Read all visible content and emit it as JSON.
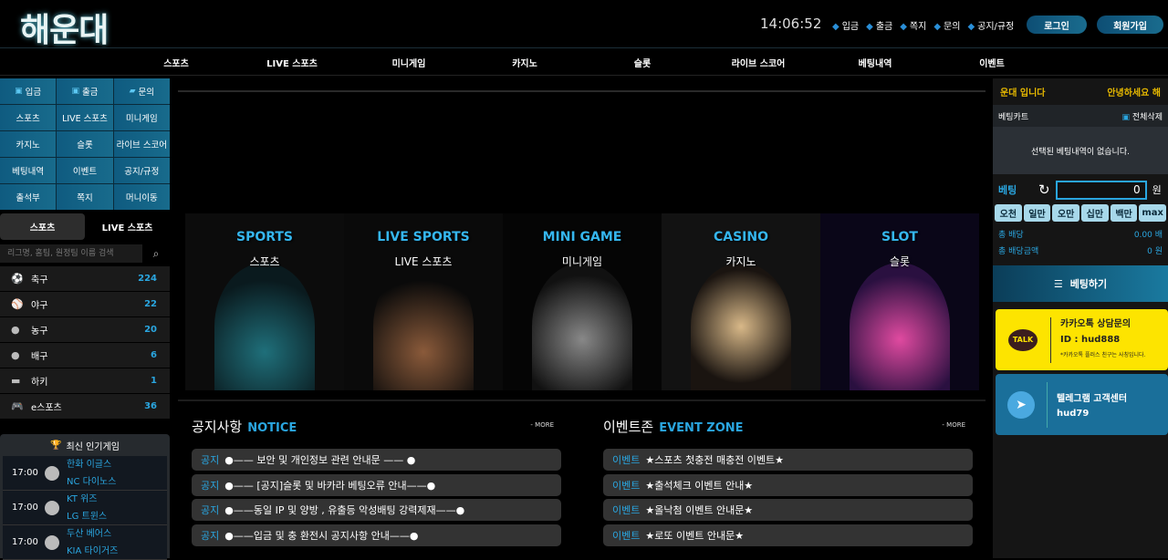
{
  "header": {
    "logo": "해운대",
    "clock": "14:06:52",
    "links": [
      "입금",
      "출금",
      "쪽지",
      "문의",
      "공지/규정"
    ],
    "login": "로그인",
    "signup": "회원가입"
  },
  "nav": [
    "스포츠",
    "LIVE 스포츠",
    "미니게임",
    "카지노",
    "슬롯",
    "라이브 스코어",
    "베팅내역",
    "이벤트"
  ],
  "quick": [
    "입금",
    "출금",
    "문의",
    "스포츠",
    "LIVE 스포츠",
    "미니게임",
    "카지노",
    "슬롯",
    "라이브 스코어",
    "베팅내역",
    "이벤트",
    "공지/규정",
    "출석부",
    "쪽지",
    "머니이동"
  ],
  "tabs": [
    "스포츠",
    "LIVE 스포츠"
  ],
  "search": {
    "placeholder": "리그명, 홈팀, 원정팀 이름 검색"
  },
  "sports": [
    {
      "icon": "soccer-ball-icon",
      "name": "축구",
      "count": "224"
    },
    {
      "icon": "baseball-icon",
      "name": "야구",
      "count": "22"
    },
    {
      "icon": "basketball-icon",
      "name": "농구",
      "count": "20"
    },
    {
      "icon": "volleyball-icon",
      "name": "배구",
      "count": "6"
    },
    {
      "icon": "hockey-puck-icon",
      "name": "하키",
      "count": "1"
    },
    {
      "icon": "gamepad-icon",
      "name": "e스포츠",
      "count": "36"
    }
  ],
  "popular": {
    "title": "최신 인기게임",
    "games": [
      {
        "time": "17:00",
        "home": "한화 이글스",
        "away": "NC 다이노스"
      },
      {
        "time": "17:00",
        "home": "KT 위즈",
        "away": "LG 트윈스"
      },
      {
        "time": "17:00",
        "home": "두산 베어스",
        "away": "KIA 타이거즈"
      }
    ]
  },
  "games": [
    {
      "en": "SPORTS",
      "ko": "스포츠"
    },
    {
      "en": "LIVE SPORTS",
      "ko": "LIVE 스포츠"
    },
    {
      "en": "MINI GAME",
      "ko": "미니게임"
    },
    {
      "en": "CASINO",
      "ko": "카지노"
    },
    {
      "en": "SLOT",
      "ko": "슬롯"
    }
  ],
  "notice": {
    "title": "공지사항",
    "sub": "NOTICE",
    "more": "MORE",
    "tag": "공지",
    "items": [
      "●—— 보안 및 개인정보 관련 안내문 —— ●",
      "●—— [공지]슬롯 및 바카라 베팅오류 안내——●",
      "●——동일 IP 및 양방 , 유출등 악성배팅 강력제재——●",
      "●——입금 및 충 환전시 공지사항 안내——●"
    ]
  },
  "event": {
    "title": "이벤트존",
    "sub": "EVENT ZONE",
    "more": "MORE",
    "tag": "이벤트",
    "items": [
      "★스포츠 첫충전 매충전 이벤트★",
      "★출석체크 이벤트 안내★",
      "★올낙첨 이벤트 안내문★",
      "★로또 이벤트 안내문★"
    ]
  },
  "betslip": {
    "marquee_left": "운대 입니다",
    "marquee_right": "안녕하세요 해",
    "cart": "베팅카트",
    "clear": "전체삭제",
    "empty": "선택된 베팅내역이 없습니다.",
    "bet_label": "베팅",
    "amount": "0",
    "unit": "원",
    "chips": [
      "오천",
      "일만",
      "오만",
      "십만",
      "백만",
      "max"
    ],
    "odds_label": "총 배당",
    "odds": "0.00 배",
    "total_label": "총 배당금액",
    "total": "0 원",
    "submit": "베팅하기"
  },
  "kakao": {
    "badge": "TALK",
    "title": "카카오톡 상담문의",
    "id": "ID : hud888",
    "note": "*카카오톡 플러스 친구는 사칭입니다."
  },
  "telegram": {
    "title": "텔레그램 고객센터",
    "id": "hud79"
  },
  "colors": {
    "accent": "#2aa6e0",
    "gold": "#e6b800",
    "kakao": "#fde400",
    "telegram": "#1a6f9a"
  }
}
